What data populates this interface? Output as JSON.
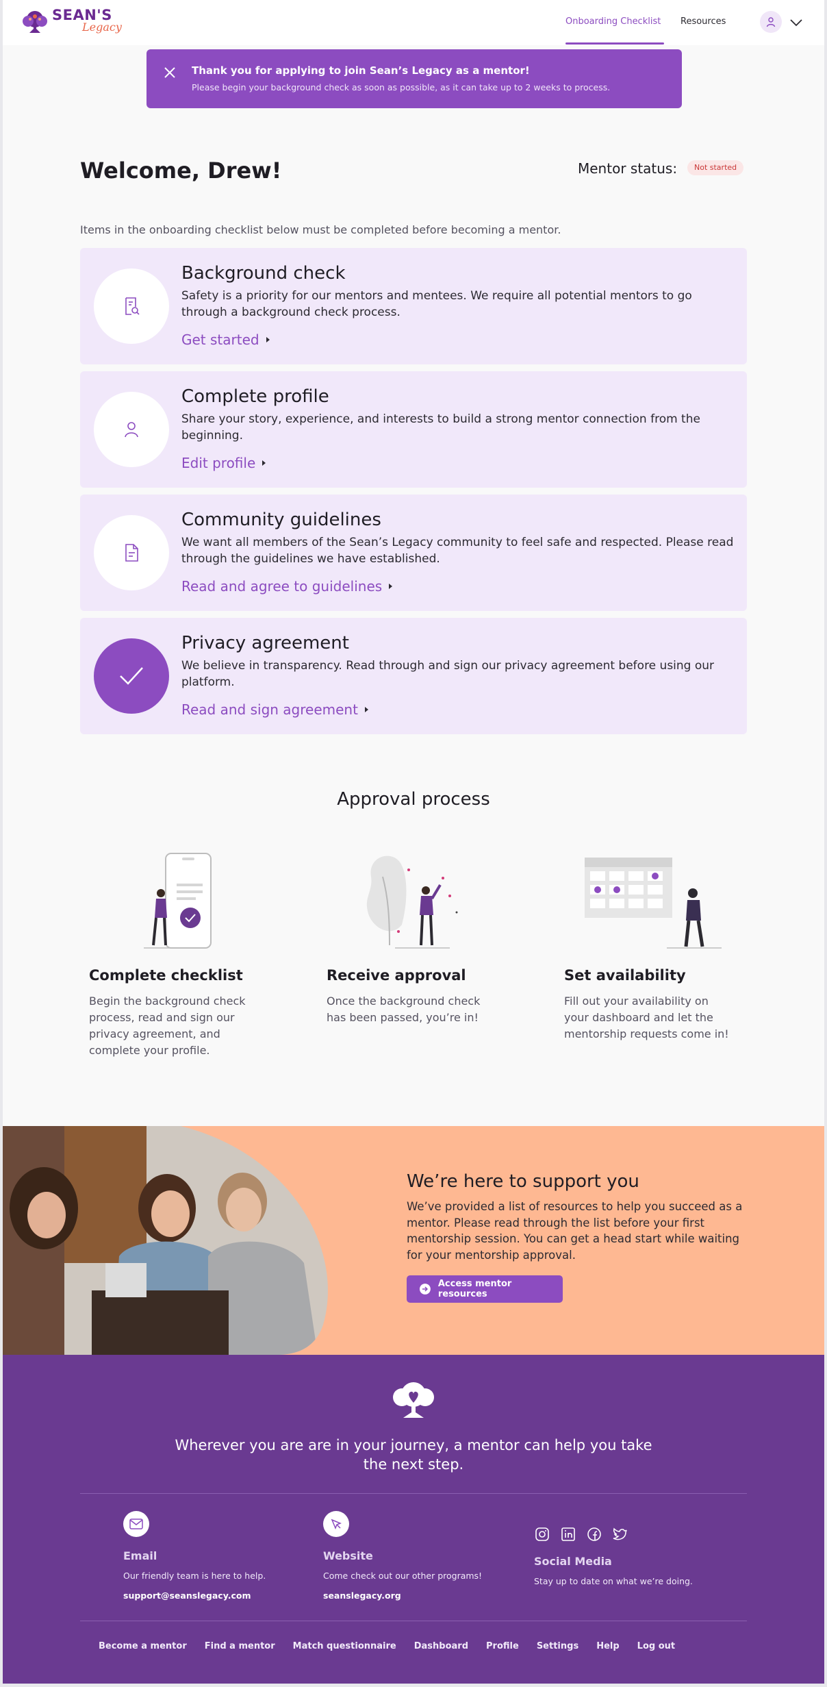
{
  "brand": {
    "name": "SEAN'S",
    "script": "Legacy"
  },
  "nav": {
    "items": [
      {
        "label": "Onboarding Checklist"
      },
      {
        "label": "Resources"
      }
    ]
  },
  "banner": {
    "title": "Thank you for applying to join Sean’s Legacy as a mentor!",
    "text": "Please begin your background check as soon as possible, as it can take up to 2 weeks to process."
  },
  "welcome": {
    "title": "Welcome, Drew!",
    "status_label": "Mentor status:",
    "status_value": "Not started",
    "intro": "Items in the onboarding checklist below must be completed before becoming a mentor."
  },
  "checklist": [
    {
      "icon": "document-search-icon",
      "title": "Background check",
      "text": "Safety is a priority for our mentors and mentees. We require all potential mentors to go through a background check process.",
      "link": "Get started",
      "done": false
    },
    {
      "icon": "user-icon",
      "title": "Complete profile",
      "text": "Share your story, experience, and interests to build a strong mentor connection from the beginning.",
      "link": "Edit profile",
      "done": false
    },
    {
      "icon": "document-icon",
      "title": "Community guidelines",
      "text": "We want all members of the Sean’s Legacy community to feel safe and respected. Please read through the guidelines we have established.",
      "link": "Read and agree to guidelines",
      "done": false
    },
    {
      "icon": "checkmark-icon",
      "title": "Privacy agreement",
      "text": "We believe in transparency. Read through and sign our privacy agreement before using our platform.",
      "link": "Read and sign agreement",
      "done": true
    }
  ],
  "approval": {
    "title": "Approval process",
    "steps": [
      {
        "title": "Complete checklist",
        "text": "Begin the background check process, read and sign our privacy agreement, and complete your profile."
      },
      {
        "title": "Receive approval",
        "text": "Once the background check has been passed, you’re in!"
      },
      {
        "title": "Set availability",
        "text": "Fill out your availability on your dashboard and let the mentorship requests come in!"
      }
    ]
  },
  "support": {
    "title": "We’re here to support you",
    "text": "We’ve provided a list of resources to help you succeed as a mentor. Please read through the list before your first mentorship session. You can get a head start while waiting for your mentorship approval.",
    "button": "Access mentor resources"
  },
  "footer": {
    "tagline": "Wherever you are are in your journey, a mentor can help you take the next step.",
    "contacts": [
      {
        "icon": "mail-icon",
        "title": "Email",
        "desc": "Our friendly team is here to help.",
        "link": "support@seanslegacy.com"
      },
      {
        "icon": "cursor-icon",
        "title": "Website",
        "desc": "Come check out our other programs!",
        "link": "seanslegacy.org"
      },
      {
        "icon": "social-icons",
        "title": "Social Media",
        "desc": "Stay up to date on what we’re doing."
      }
    ],
    "links": [
      "Become a mentor",
      "Find a mentor",
      "Match questionnaire",
      "Dashboard",
      "Profile",
      "Settings",
      "Help",
      "Log out"
    ]
  },
  "colors": {
    "primary": "#8c4cc0",
    "primary_dark": "#6a3a91",
    "card_bg": "#f1e8fa",
    "support_bg": "#feb892",
    "status_red": "#c93838"
  }
}
